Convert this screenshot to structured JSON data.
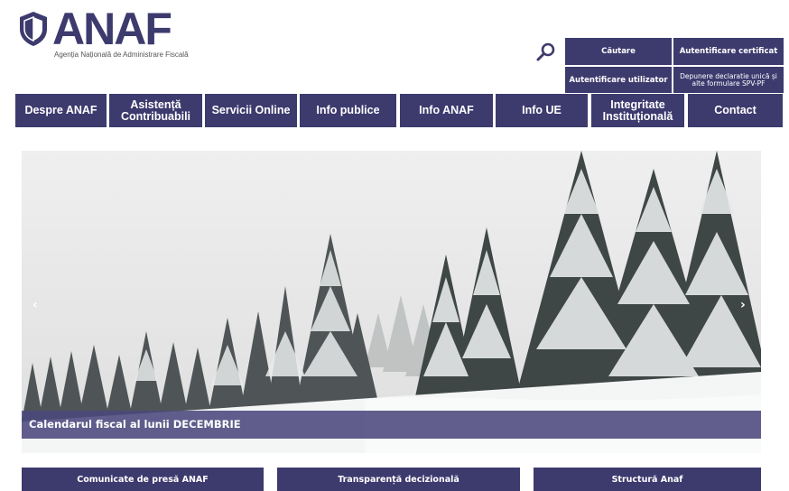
{
  "header": {
    "logo_text": "ANAF",
    "logo_subtitle": "Agenția Națională de Administrare Fiscală",
    "search_icon": "search-icon",
    "links": {
      "search": "Căutare",
      "certificate_auth": "Autentificare certificat",
      "user_auth": "Autentificare utilizator",
      "submit_declaration": "Depunere declaratie unică și alte formulare SPV-PF"
    }
  },
  "nav": {
    "items": [
      {
        "label": "Despre ANAF"
      },
      {
        "label": "Asistență Contribuabili"
      },
      {
        "label": "Servicii Online"
      },
      {
        "label": "Info publice"
      },
      {
        "label": "Info ANAF"
      },
      {
        "label": "Info UE"
      },
      {
        "label": "Integritate Instituțională"
      },
      {
        "label": "Contact"
      }
    ]
  },
  "slider": {
    "caption": "Calendarul fiscal al lunii DECEMBRIE",
    "prev": "‹",
    "next": "›"
  },
  "bottom": {
    "press": "Comunicate de presă ANAF",
    "transparency": "Transparență decizională",
    "structure": "Structură Anaf"
  },
  "colors": {
    "brand": "#3d3a6e",
    "caption_band": "#4b487d"
  }
}
